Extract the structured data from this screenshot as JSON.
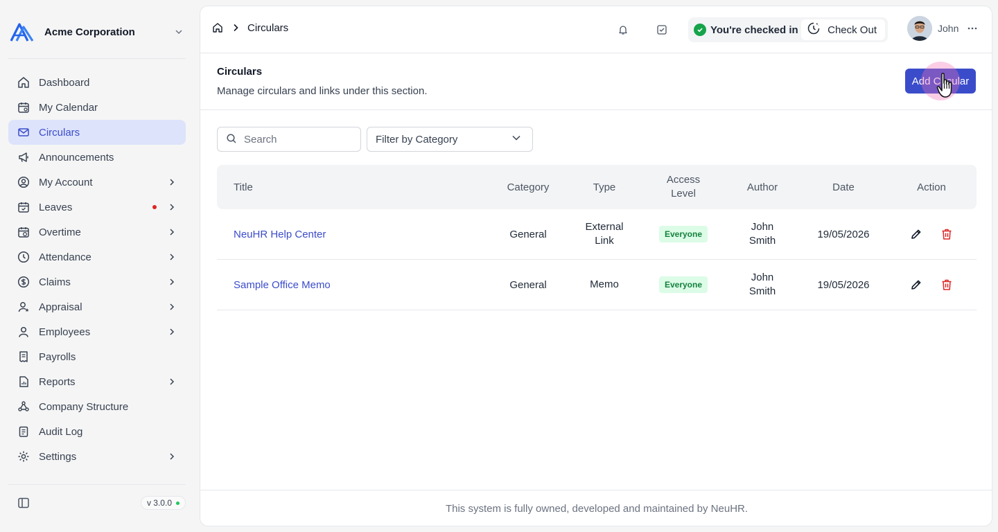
{
  "org": {
    "name": "Acme Corporation"
  },
  "sidebar": {
    "items": [
      {
        "label": "Dashboard",
        "icon": "home-icon"
      },
      {
        "label": "My Calendar",
        "icon": "calendar-icon"
      },
      {
        "label": "Circulars",
        "icon": "mail-icon",
        "active": true
      },
      {
        "label": "Announcements",
        "icon": "megaphone-icon"
      },
      {
        "label": "My Account",
        "icon": "user-circle-icon",
        "expandable": true
      },
      {
        "label": "Leaves",
        "icon": "calendar-check-icon",
        "expandable": true,
        "dot": true
      },
      {
        "label": "Overtime",
        "icon": "calendar-clock-icon",
        "expandable": true
      },
      {
        "label": "Attendance",
        "icon": "clock-icon",
        "expandable": true
      },
      {
        "label": "Claims",
        "icon": "dollar-circle-icon",
        "expandable": true
      },
      {
        "label": "Appraisal",
        "icon": "user-star-icon",
        "expandable": true
      },
      {
        "label": "Employees",
        "icon": "user-icon",
        "expandable": true
      },
      {
        "label": "Payrolls",
        "icon": "receipt-icon"
      },
      {
        "label": "Reports",
        "icon": "file-chart-icon",
        "expandable": true
      },
      {
        "label": "Company Structure",
        "icon": "network-icon"
      },
      {
        "label": "Audit Log",
        "icon": "clipboard-list-icon"
      },
      {
        "label": "Settings",
        "icon": "gear-icon",
        "expandable": true
      }
    ],
    "version": "v 3.0.0"
  },
  "topbar": {
    "breadcrumb": "Circulars",
    "status": "You're checked in",
    "checkout_label": "Check Out",
    "user_name": "John"
  },
  "page": {
    "title": "Circulars",
    "subtitle": "Manage circulars and links under this section.",
    "add_button": "Add Circular"
  },
  "filters": {
    "search_placeholder": "Search",
    "category_placeholder": "Filter by Category"
  },
  "table": {
    "headers": {
      "title": "Title",
      "category": "Category",
      "type": "Type",
      "access_line1": "Access",
      "access_line2": "Level",
      "author": "Author",
      "date": "Date",
      "action": "Action"
    },
    "rows": [
      {
        "title": "NeuHR Help Center",
        "category": "General",
        "type_line1": "External",
        "type_line2": "Link",
        "access": "Everyone",
        "author_line1": "John",
        "author_line2": "Smith",
        "date": "19/05/2026"
      },
      {
        "title": "Sample Office Memo",
        "category": "General",
        "type_line1": "Memo",
        "type_line2": "",
        "access": "Everyone",
        "author_line1": "John",
        "author_line2": "Smith",
        "date": "19/05/2026"
      }
    ]
  },
  "footer": {
    "text": "This system is fully owned, developed and maintained by NeuHR."
  },
  "colors": {
    "accent": "#3b4cca",
    "active_bg": "#dde3fb",
    "success": "#16a34a",
    "danger": "#dc2626"
  }
}
